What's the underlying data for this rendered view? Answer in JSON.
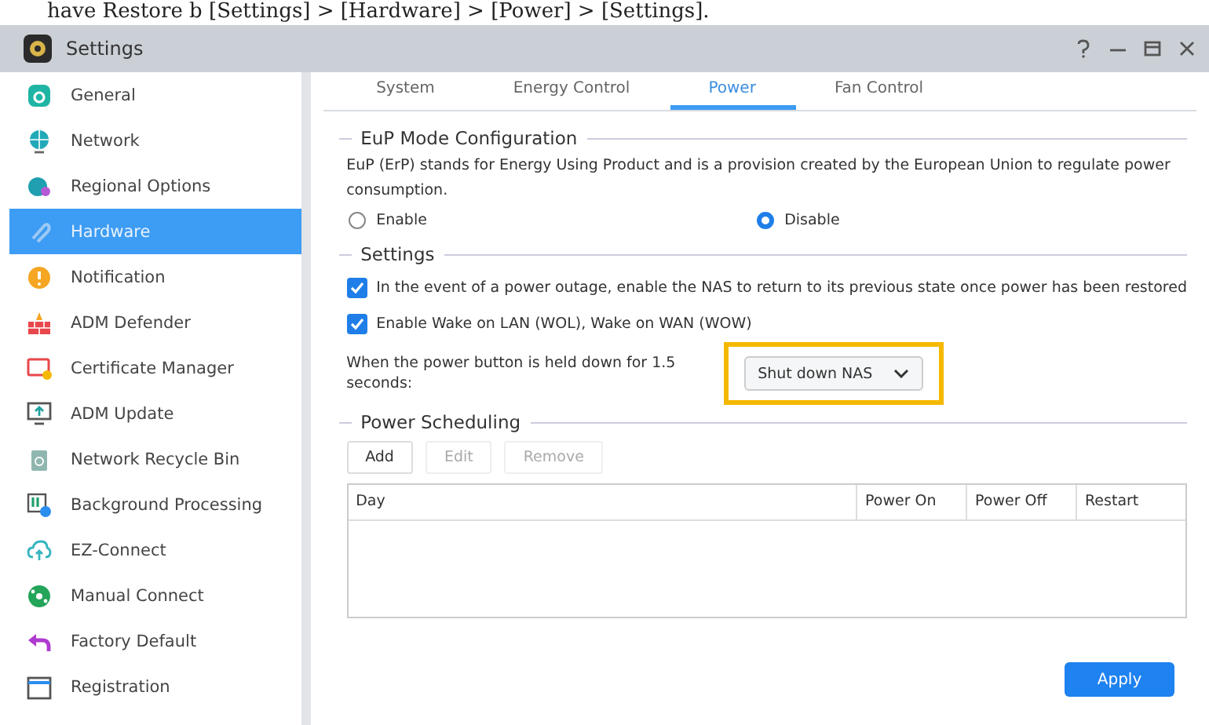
{
  "doc_caption": "have Restore b [Settings] > [Hardware] > [Power] > [Settings].",
  "window": {
    "title": "Settings"
  },
  "sidebar": {
    "items": [
      {
        "label": "General",
        "selected": false
      },
      {
        "label": "Network",
        "selected": false
      },
      {
        "label": "Regional Options",
        "selected": false
      },
      {
        "label": "Hardware",
        "selected": true
      },
      {
        "label": "Notification",
        "selected": false
      },
      {
        "label": "ADM Defender",
        "selected": false
      },
      {
        "label": "Certificate Manager",
        "selected": false
      },
      {
        "label": "ADM Update",
        "selected": false
      },
      {
        "label": "Network Recycle Bin",
        "selected": false
      },
      {
        "label": "Background Processing",
        "selected": false
      },
      {
        "label": "EZ-Connect",
        "selected": false
      },
      {
        "label": "Manual Connect",
        "selected": false
      },
      {
        "label": "Factory Default",
        "selected": false
      },
      {
        "label": "Registration",
        "selected": false
      }
    ]
  },
  "tabs": [
    {
      "label": "System",
      "selected": false
    },
    {
      "label": "Energy Control",
      "selected": false
    },
    {
      "label": "Power",
      "selected": true
    },
    {
      "label": "Fan Control",
      "selected": false
    }
  ],
  "eup": {
    "title": "EuP Mode Configuration",
    "description": "EuP (ErP) stands for Energy Using Product and is a provision created by the European Union to regulate power consumption.",
    "options": [
      {
        "label": "Enable",
        "selected": false
      },
      {
        "label": "Disable",
        "selected": true
      }
    ]
  },
  "settings": {
    "title": "Settings",
    "checkboxes": [
      {
        "label": "In the event of a power outage, enable the NAS to return to its previous state once power has been restored",
        "checked": true
      },
      {
        "label": "Enable Wake on LAN (WOL), Wake on WAN (WOW)",
        "checked": true
      }
    ],
    "power_button": {
      "label": "When the power button is held down for 1.5 seconds:",
      "value": "Shut down NAS",
      "highlighted": true
    }
  },
  "scheduling": {
    "title": "Power Scheduling",
    "buttons": [
      {
        "label": "Add",
        "disabled": false
      },
      {
        "label": "Edit",
        "disabled": true
      },
      {
        "label": "Remove",
        "disabled": true
      }
    ],
    "columns": [
      "Day",
      "Power On",
      "Power Off",
      "Restart"
    ]
  },
  "apply_button": "Apply"
}
